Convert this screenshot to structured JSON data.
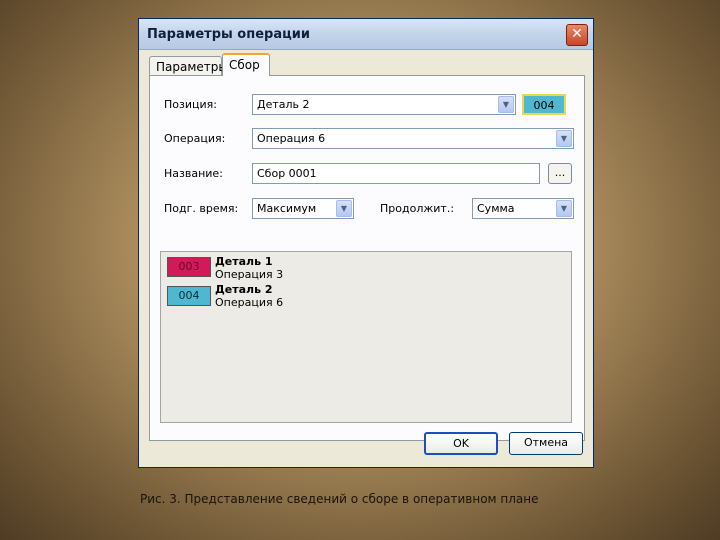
{
  "window": {
    "title": "Параметры операции",
    "close_glyph": "✕"
  },
  "tabs": [
    {
      "label": "Параметры"
    },
    {
      "label": "Сбор"
    }
  ],
  "form": {
    "position": {
      "label": "Позиция:",
      "value": "Деталь 2",
      "badge": "004"
    },
    "operation": {
      "label": "Операция:",
      "value": "Операция 6"
    },
    "name": {
      "label": "Название:",
      "value": "Сбор 0001",
      "browse": "..."
    },
    "prep_time": {
      "label": "Подг. время:",
      "value": "Максимум"
    },
    "duration": {
      "label": "Продолжит.:",
      "value": "Сумма"
    }
  },
  "list": [
    {
      "code": "003",
      "code_color": "#d4195a",
      "title": "Деталь 1",
      "subtitle": "Операция 3"
    },
    {
      "code": "004",
      "code_color": "#4fb8d0",
      "title": "Деталь 2",
      "subtitle": "Операция 6"
    }
  ],
  "buttons": {
    "ok": "OK",
    "cancel": "Отмена"
  },
  "colors": {
    "badge_004": "#4fb8d0",
    "badge_003": "#d4195a"
  },
  "caption": "Рис. 3. Представление сведений о сборе в оперативном плане"
}
